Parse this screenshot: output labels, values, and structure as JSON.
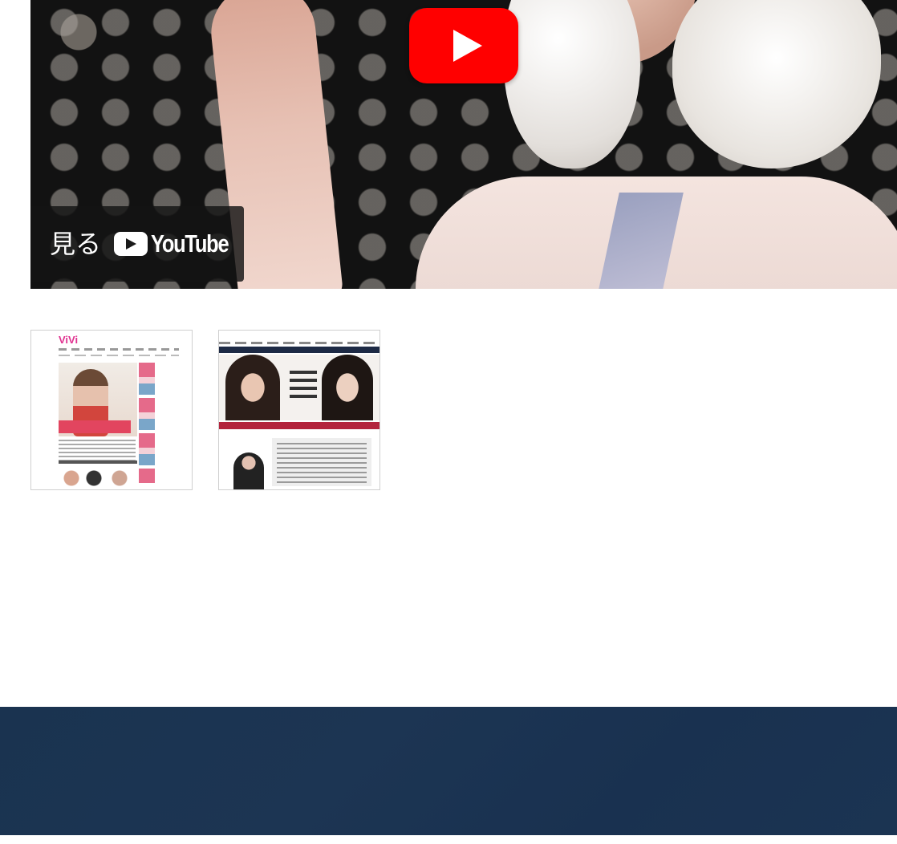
{
  "video": {
    "watch_label": "見る",
    "youtube_label": "YouTube",
    "play_button_color": "#ff0000"
  },
  "thumbnails": [
    {
      "logo_text": "ViVi",
      "accent_color": "#e0308f"
    },
    {
      "accent_color": "#b3243d"
    }
  ],
  "footer": {
    "background_color": "#1b3452"
  }
}
